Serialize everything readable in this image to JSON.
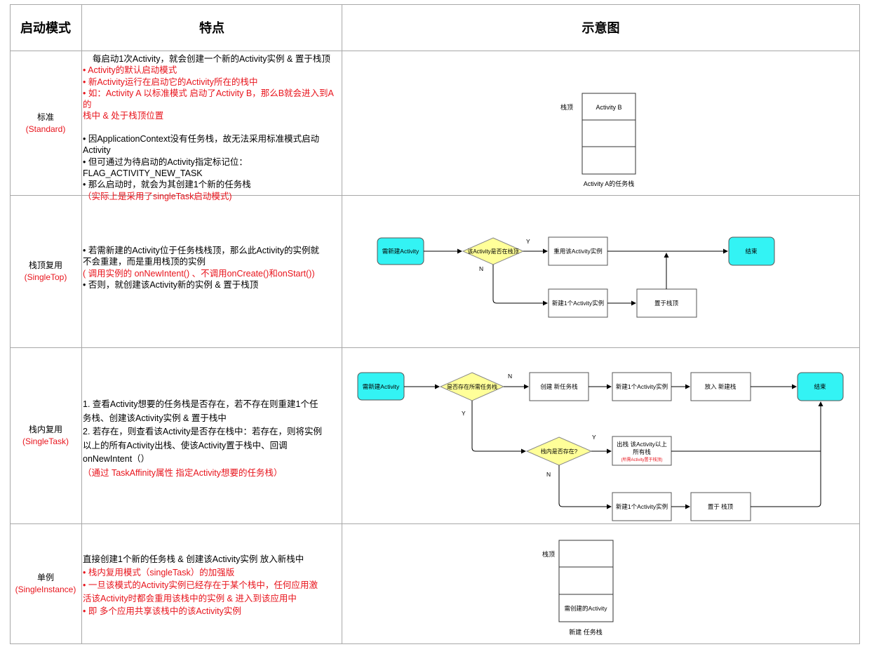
{
  "headers": {
    "mode": "启动模式",
    "feature": "特点",
    "diagram": "示意图"
  },
  "rows": [
    {
      "mode": "标准",
      "mode_en": "(Standard)",
      "lines": [
        {
          "t": "    每启动1次Activity，就会创建一个新的Activity实例 & 置于栈顶",
          "c": "black"
        },
        {
          "t": "• Activity的默认启动模式",
          "c": "red"
        },
        {
          "t": "• 新Activity运行在启动它的Activity所在的栈中",
          "c": "red"
        },
        {
          "t": "• 如：Activity A 以标准模式 启动了Activity B，那么B就会进入到A的",
          "c": "red"
        },
        {
          "t": "栈中 & 处于栈顶位置",
          "c": "red"
        },
        {
          "t": " ",
          "c": "black"
        },
        {
          "t": "• 因ApplicationContext没有任务栈，故无法采用标准模式启动",
          "c": "black"
        },
        {
          "t": "Activity",
          "c": "black"
        },
        {
          "t": "• 但可通过为待启动的Activity指定标记位：",
          "c": "black"
        },
        {
          "t": "FLAG_ACTIVITY_NEW_TASK",
          "c": "black"
        },
        {
          "t": "• 那么启动时，就会为其创建1个新的任务栈",
          "c": "black"
        },
        {
          "t": "（实际上是采用了singleTask启动模式)",
          "c": "red"
        }
      ],
      "diagram": {
        "top_label": "栈顶",
        "top_box": "Activity B",
        "caption": "Activity A的任务栈"
      }
    },
    {
      "mode": "栈顶复用",
      "mode_en": "(SingleTop)",
      "lines": [
        {
          "t": "• 若需新建的Activity位于任务栈栈顶，那么此Activity的实例就",
          "c": "black"
        },
        {
          "t": "不会重建，而是重用栈顶的实例",
          "c": "black"
        },
        {
          "t": "( 调用实例的 onNewIntent() 、不调用onCreate()和onStart())",
          "c": "red"
        },
        {
          "t": "• 否则，就创建该Activity新的实例 & 置于栈顶",
          "c": "black"
        }
      ],
      "diagram": {
        "start": "需新建Activity",
        "decision": "该Activity是否在栈顶",
        "yes": "Y",
        "no": "N",
        "reuse": "重用该Activity实例",
        "end": "结束",
        "create": "新建1个Activity实例",
        "place": "置于栈顶"
      }
    },
    {
      "mode": "栈内复用",
      "mode_en": "(SingleTask)",
      "lines": [
        {
          "t": "1. 查看Activity想要的任务栈是否存在，若不存在则重建1个任",
          "c": "black"
        },
        {
          "t": "务栈、创建该Activity实例 & 置于栈中",
          "c": "black"
        },
        {
          "t": "2. 若存在，则查看该Activity是否存在栈中：若存在，则将实例",
          "c": "black"
        },
        {
          "t": "以上的所有Activity出栈、使该Activity置于栈中、回调",
          "c": "black"
        },
        {
          "t": "onNewIntent（）",
          "c": "black"
        },
        {
          "t": "（通过 TaskAffinity属性 指定Activity想要的任务栈）",
          "c": "red"
        }
      ],
      "diagram": {
        "start": "需新建Activity",
        "decision1": "是否存在所需任务栈",
        "create_stack": "创建 新任务栈",
        "new_instance": "新建1个Activity实例",
        "put_stack": "放入 新建栈",
        "end": "结束",
        "decision2": "栈内是否存在?",
        "pop_line1": "出栈 该Activity以上",
        "pop_line2": "所有栈",
        "pop_note": "(所需Activity置于栈顶)",
        "new_instance2": "新建1个Activity实例",
        "place_top": "置于 栈顶",
        "yes": "Y",
        "no": "N"
      }
    },
    {
      "mode": "单例",
      "mode_en": "(SingleInstance)",
      "lines": [
        {
          "t": "直接创建1个新的任务栈 & 创建该Activity实例 放入新栈中",
          "c": "black"
        },
        {
          "t": "• 栈内复用模式（singleTask）的加强版",
          "c": "red"
        },
        {
          "t": "• 一旦该模式的Activity实例已经存在于某个栈中，任何应用激",
          "c": "red"
        },
        {
          "t": "活该Activity时都会重用该栈中的实例 & 进入到该应用中",
          "c": "red"
        },
        {
          "t": "• 即 多个应用共享该栈中的该Activity实例",
          "c": "red"
        }
      ],
      "diagram": {
        "top_label": "栈顶",
        "bottom_box": "需创建的Activity",
        "caption": "新建 任务栈"
      }
    }
  ],
  "colors": {
    "grid": "#a8a8a8",
    "red": "#e8141c",
    "cyan": "#33f3f4",
    "yellow": "#ffff99"
  }
}
